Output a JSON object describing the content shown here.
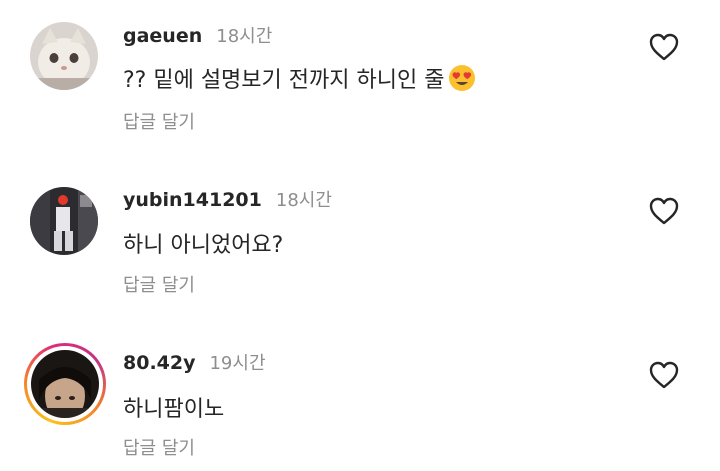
{
  "comments": [
    {
      "username": "gaeuen",
      "time": "18시간",
      "text": "?? 밑에 설명보기 전까지 하니인 줄",
      "emoji": "heart-eyes-emoji",
      "reply_label": "답글 달기",
      "like_icon": "heart-outline-icon"
    },
    {
      "username": "yubin141201",
      "time": "18시간",
      "text": "하니 아니었어요?",
      "reply_label": "답글 달기",
      "like_icon": "heart-outline-icon"
    },
    {
      "username": "80.42y",
      "time": "19시간",
      "text": "하니팜이노",
      "reply_label": "답글 달기",
      "like_icon": "heart-outline-icon",
      "has_story_ring": true
    }
  ],
  "colors": {
    "text_primary": "#262626",
    "text_secondary": "#8e8e8e",
    "background": "#ffffff"
  }
}
